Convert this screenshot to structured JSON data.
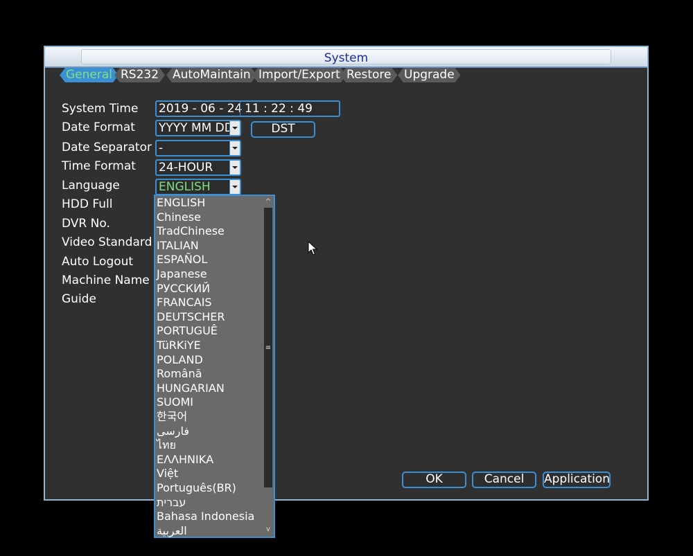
{
  "window": {
    "title": "System"
  },
  "tabs": [
    {
      "label": "General",
      "active": true
    },
    {
      "label": "RS232"
    },
    {
      "label": "AutoMaintain"
    },
    {
      "label": "Import/Export"
    },
    {
      "label": "Restore"
    },
    {
      "label": "Upgrade"
    }
  ],
  "form": {
    "system_time_label": "System Time",
    "system_date": "2019 - 06 - 24",
    "system_clock": "11 : 22 : 49",
    "date_format_label": "Date Format",
    "date_format_value": "YYYY MM DD",
    "dst_label": "DST",
    "date_separator_label": "Date Separator",
    "date_separator_value": "-",
    "time_format_label": "Time Format",
    "time_format_value": "24-HOUR",
    "language_label": "Language",
    "language_value": "ENGLISH",
    "hdd_full_label": "HDD Full",
    "dvr_no_label": "DVR No.",
    "video_standard_label": "Video Standard",
    "auto_logout_label": "Auto Logout",
    "machine_name_label": "Machine Name",
    "guide_label": "Guide"
  },
  "language_options": [
    "ENGLISH",
    "Chinese",
    "TradChinese",
    "ITALIAN",
    "ESPAÑOL",
    "Japanese",
    "РУССКИЙ",
    "FRANCAIS",
    "DEUTSCHER",
    "PORTUGUÊ",
    "TüRKiYE",
    "POLAND",
    "Română",
    "HUNGARIAN",
    "SUOMI",
    "한국어",
    "فارسی",
    "ไทย",
    "ΕΛΛΗΝΙΚΑ",
    "Việt",
    "Português(BR)",
    "עברית",
    "Bahasa Indonesia",
    "العربية"
  ],
  "scrollbar": {
    "up": "^",
    "thumb": "≡",
    "down": "v"
  },
  "buttons": {
    "ok": "OK",
    "cancel": "Cancel",
    "application": "Application"
  },
  "colors": {
    "accent": "#3b8fd3",
    "active_text": "#7fe07f",
    "title_text": "#1a2f9c"
  }
}
